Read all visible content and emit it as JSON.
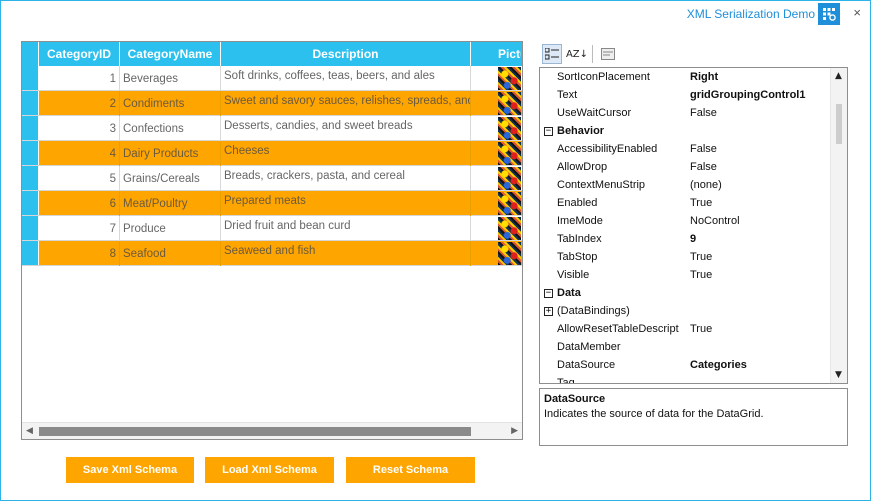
{
  "window": {
    "title": "XML Serialization Demo",
    "close_glyph": "×",
    "title_icon": "grid-settings-icon"
  },
  "grid": {
    "columns": [
      "CategoryID",
      "CategoryName",
      "Description",
      "Pictu"
    ],
    "rows": [
      {
        "id": "1",
        "name": "Beverages",
        "desc": "Soft drinks, coffees, teas, beers, and ales"
      },
      {
        "id": "2",
        "name": "Condiments",
        "desc": "Sweet and savory sauces, relishes, spreads, and seasonings"
      },
      {
        "id": "3",
        "name": "Confections",
        "desc": "Desserts, candies, and sweet breads"
      },
      {
        "id": "4",
        "name": "Dairy Products",
        "desc": "Cheeses"
      },
      {
        "id": "5",
        "name": "Grains/Cereals",
        "desc": "Breads, crackers, pasta, and cereal"
      },
      {
        "id": "6",
        "name": "Meat/Poultry",
        "desc": "Prepared meats"
      },
      {
        "id": "7",
        "name": "Produce",
        "desc": "Dried fruit and bean curd"
      },
      {
        "id": "8",
        "name": "Seafood",
        "desc": "Seaweed and fish"
      }
    ],
    "header_color": "#2cc0ef",
    "alt_row_color": "#ffa500"
  },
  "property_grid": {
    "toolbar": {
      "categorized_icon": "categorized-icon",
      "alphabetical_label": "AZ↓",
      "property_pages_icon": "property-pages-icon"
    },
    "rows": [
      {
        "kind": "prop",
        "name": "SortIconPlacement",
        "value": "Right",
        "bold": true
      },
      {
        "kind": "prop",
        "name": "Text",
        "value": "gridGroupingControl1",
        "bold": true
      },
      {
        "kind": "prop",
        "name": "UseWaitCursor",
        "value": "False",
        "bold": false
      },
      {
        "kind": "cat",
        "name": "Behavior",
        "expander": "−"
      },
      {
        "kind": "prop",
        "name": "AccessibilityEnabled",
        "value": "False",
        "bold": false
      },
      {
        "kind": "prop",
        "name": "AllowDrop",
        "value": "False",
        "bold": false
      },
      {
        "kind": "prop",
        "name": "ContextMenuStrip",
        "value": "(none)",
        "bold": false
      },
      {
        "kind": "prop",
        "name": "Enabled",
        "value": "True",
        "bold": false
      },
      {
        "kind": "prop",
        "name": "ImeMode",
        "value": "NoControl",
        "bold": false
      },
      {
        "kind": "prop",
        "name": "TabIndex",
        "value": "9",
        "bold": true
      },
      {
        "kind": "prop",
        "name": "TabStop",
        "value": "True",
        "bold": false
      },
      {
        "kind": "prop",
        "name": "Visible",
        "value": "True",
        "bold": false
      },
      {
        "kind": "cat",
        "name": "Data",
        "expander": "−"
      },
      {
        "kind": "sub",
        "name": "(DataBindings)",
        "value": "",
        "bold": false,
        "expander": "+"
      },
      {
        "kind": "prop",
        "name": "AllowResetTableDescript",
        "value": "True",
        "bold": false
      },
      {
        "kind": "prop",
        "name": "DataMember",
        "value": "",
        "bold": false
      },
      {
        "kind": "prop",
        "name": "DataSource",
        "value": "Categories",
        "bold": true
      },
      {
        "kind": "prop",
        "name": "Tag",
        "value": "",
        "bold": false
      }
    ],
    "description": {
      "title": "DataSource",
      "text": "Indicates the source of data for the DataGrid."
    }
  },
  "buttons": {
    "save": "Save Xml Schema",
    "load": "Load Xml Schema",
    "reset": "Reset Schema",
    "color": "#ffa500"
  }
}
